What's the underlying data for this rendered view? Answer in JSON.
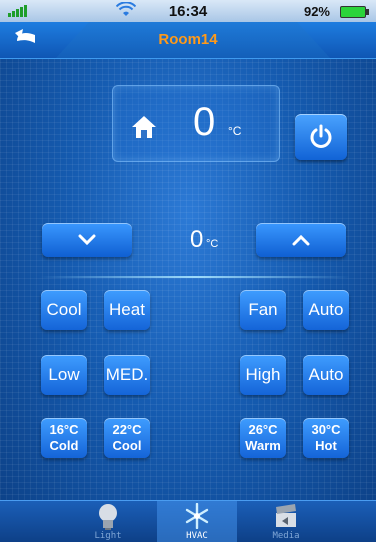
{
  "status_bar": {
    "time": "16:34",
    "battery": "92%"
  },
  "header": {
    "title": "Room14"
  },
  "room": {
    "temperature": "0",
    "unit": "°C"
  },
  "setpoint": {
    "temperature": "0",
    "unit": "°C"
  },
  "modes": {
    "cool": "Cool",
    "heat": "Heat",
    "fan": "Fan",
    "auto": "Auto"
  },
  "fan_speeds": {
    "low": "Low",
    "med": "MED.",
    "high": "High",
    "auto": "Auto"
  },
  "presets": [
    {
      "temp": "16°C",
      "label": "Cold"
    },
    {
      "temp": "22°C",
      "label": "Cool"
    },
    {
      "temp": "26°C",
      "label": "Warm"
    },
    {
      "temp": "30°C",
      "label": "Hot"
    }
  ],
  "tabs": [
    {
      "label": "Light",
      "icon": "bulb-icon"
    },
    {
      "label": "HVAC",
      "icon": "snowflake-icon",
      "active": true
    },
    {
      "label": "Media",
      "icon": "clapperboard-icon"
    }
  ],
  "colors": {
    "title": "#ff9a1a",
    "accent": "#1f7ad8",
    "battery": "#2bd33a"
  }
}
